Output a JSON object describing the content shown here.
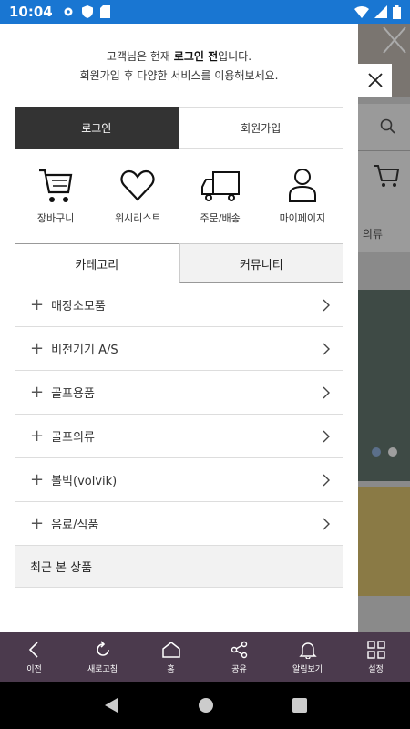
{
  "status_bar": {
    "time": "10:04"
  },
  "drawer": {
    "message_prefix": "고객님은 현재 ",
    "message_bold": "로그인 전",
    "message_suffix": "입니다.",
    "message_line2": "회원가입 후 다양한 서비스를 이용해보세요.",
    "login_label": "로그인",
    "signup_label": "회원가입",
    "quick_links": [
      {
        "label": "장바구니",
        "icon": "cart-icon"
      },
      {
        "label": "위시리스트",
        "icon": "heart-icon"
      },
      {
        "label": "주문/배송",
        "icon": "truck-icon"
      },
      {
        "label": "마이페이지",
        "icon": "user-icon"
      }
    ],
    "tabs": [
      {
        "label": "카테고리"
      },
      {
        "label": "커뮤니티"
      }
    ],
    "categories": [
      {
        "label": "매장소모품"
      },
      {
        "label": "비전기기 A/S"
      },
      {
        "label": "골프용품"
      },
      {
        "label": "골프의류"
      },
      {
        "label": "볼빅(volvik)"
      },
      {
        "label": "음료/식품"
      }
    ],
    "recent_label": "최근 본 상품"
  },
  "background": {
    "partial_label": "의류"
  },
  "bottom_nav": [
    {
      "label": "이전",
      "icon": "back-icon"
    },
    {
      "label": "새로고침",
      "icon": "refresh-icon"
    },
    {
      "label": "홈",
      "icon": "home-icon"
    },
    {
      "label": "공유",
      "icon": "share-icon"
    },
    {
      "label": "알림보기",
      "icon": "bell-icon"
    },
    {
      "label": "설정",
      "icon": "grid-icon"
    }
  ]
}
